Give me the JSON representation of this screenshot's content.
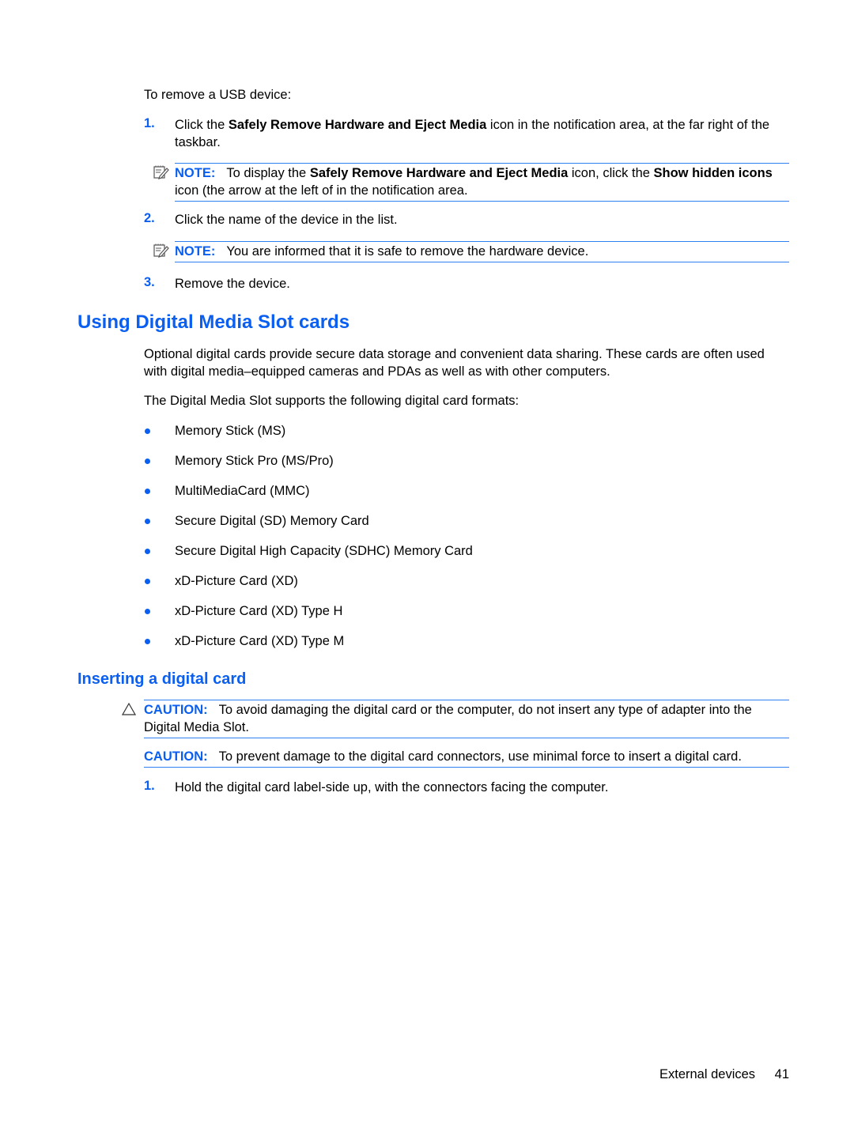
{
  "intro": "To remove a USB device:",
  "steps_usb": [
    {
      "num": "1.",
      "pre": "Click the ",
      "bold": "Safely Remove Hardware and Eject Media",
      "post": " icon in the notification area, at the far right of the taskbar."
    },
    {
      "num": "2.",
      "text": "Click the name of the device in the list."
    },
    {
      "num": "3.",
      "text": "Remove the device."
    }
  ],
  "note1": {
    "label": "NOTE:",
    "pre": "To display the ",
    "bold1": "Safely Remove Hardware and Eject Media",
    "mid": " icon, click the ",
    "bold2": "Show hidden icons",
    "post": " icon (the arrow at the left of in the notification area."
  },
  "note2": {
    "label": "NOTE:",
    "text": "You are informed that it is safe to remove the hardware device."
  },
  "section": {
    "title": "Using Digital Media Slot cards",
    "para1": "Optional digital cards provide secure data storage and convenient data sharing. These cards are often used with digital media–equipped cameras and PDAs as well as with other computers.",
    "para2": "The Digital Media Slot supports the following digital card formats:",
    "formats": [
      "Memory Stick (MS)",
      "Memory Stick Pro (MS/Pro)",
      "MultiMediaCard (MMC)",
      "Secure Digital (SD) Memory Card",
      "Secure Digital High Capacity (SDHC) Memory Card",
      "xD-Picture Card (XD)",
      "xD-Picture Card (XD) Type H",
      "xD-Picture Card (XD) Type M"
    ]
  },
  "subsection": {
    "title": "Inserting a digital card",
    "caution1": {
      "label": "CAUTION:",
      "text": "To avoid damaging the digital card or the computer, do not insert any type of adapter into the Digital Media Slot."
    },
    "caution2": {
      "label": "CAUTION:",
      "text": "To prevent damage to the digital card connectors, use minimal force to insert a digital card."
    },
    "step1": {
      "num": "1.",
      "text": "Hold the digital card label-side up, with the connectors facing the computer."
    }
  },
  "footer": {
    "section": "External devices",
    "page": "41"
  }
}
